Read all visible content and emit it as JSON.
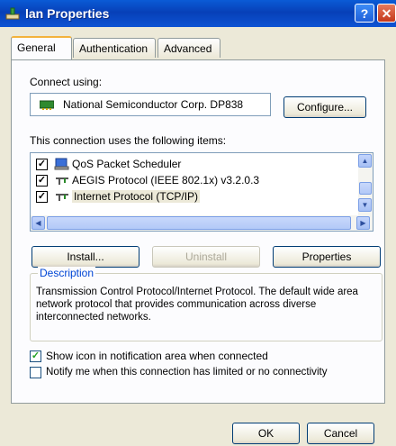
{
  "window": {
    "title": "lan Properties",
    "help_glyph": "?",
    "close_glyph": "✕"
  },
  "tabs": [
    {
      "label": "General",
      "active": true
    },
    {
      "label": "Authentication",
      "active": false
    },
    {
      "label": "Advanced",
      "active": false
    }
  ],
  "general": {
    "connect_using_label": "Connect using:",
    "adapter_name": "National Semiconductor Corp. DP838",
    "configure_button": "Configure...",
    "items_label": "This connection uses the following items:",
    "items": [
      {
        "label": "QoS Packet Scheduler",
        "checked": true,
        "icon": "scheduler-icon"
      },
      {
        "label": "AEGIS Protocol (IEEE 802.1x) v3.2.0.3",
        "checked": true,
        "icon": "protocol-icon"
      },
      {
        "label": "Internet Protocol (TCP/IP)",
        "checked": true,
        "icon": "protocol-icon",
        "selected": true
      }
    ],
    "install_button": "Install...",
    "uninstall_button": "Uninstall",
    "properties_button": "Properties",
    "description_title": "Description",
    "description_text": "Transmission Control Protocol/Internet Protocol. The default wide area network protocol that provides communication across diverse interconnected networks.",
    "show_icon_label": "Show icon in notification area when connected",
    "show_icon_checked": true,
    "notify_label": "Notify me when this connection has limited or no connectivity",
    "notify_checked": false
  },
  "footer": {
    "ok_button": "OK",
    "cancel_button": "Cancel"
  },
  "colors": {
    "title_bar": "#0a5bd6",
    "dialog_bg": "#ece9d8",
    "group_title": "#0046d5"
  }
}
